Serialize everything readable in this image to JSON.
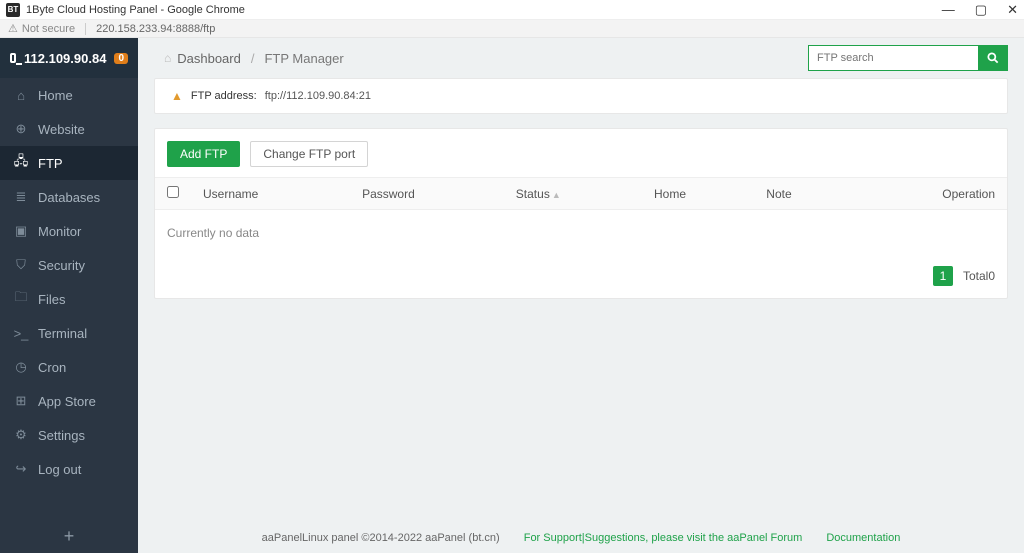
{
  "window": {
    "title": "1Byte Cloud Hosting Panel - Google Chrome",
    "favicon_text": "BT"
  },
  "address_bar": {
    "not_secure": "Not secure",
    "url": "220.158.233.94:8888/ftp"
  },
  "sidebar": {
    "host": "112.109.90.84",
    "badge": "0",
    "items": [
      {
        "label": "Home",
        "icon": "⌂"
      },
      {
        "label": "Website",
        "icon": "⊕"
      },
      {
        "label": "FTP",
        "icon": "🖧",
        "active": true
      },
      {
        "label": "Databases",
        "icon": "≣"
      },
      {
        "label": "Monitor",
        "icon": "▣"
      },
      {
        "label": "Security",
        "icon": "⛉"
      },
      {
        "label": "Files",
        "icon": "🗀"
      },
      {
        "label": "Terminal",
        "icon": ">_"
      },
      {
        "label": "Cron",
        "icon": "◷"
      },
      {
        "label": "App Store",
        "icon": "⊞"
      },
      {
        "label": "Settings",
        "icon": "⚙"
      },
      {
        "label": "Log out",
        "icon": "↪"
      }
    ]
  },
  "breadcrumb": {
    "root": "Dashboard",
    "current": "FTP Manager"
  },
  "search": {
    "placeholder": "FTP search"
  },
  "alert": {
    "label": "FTP address:",
    "value": "ftp://112.109.90.84:21"
  },
  "buttons": {
    "add": "Add FTP",
    "change_port": "Change FTP port"
  },
  "table": {
    "headers": {
      "username": "Username",
      "password": "Password",
      "status": "Status",
      "home": "Home",
      "note": "Note",
      "operation": "Operation"
    },
    "empty": "Currently no data"
  },
  "pager": {
    "page": "1",
    "total_label": "Total0"
  },
  "footer": {
    "copyright": "aaPanelLinux panel ©2014-2022 aaPanel (bt.cn)",
    "support": "For Support|Suggestions, please visit the aaPanel Forum",
    "docs": "Documentation"
  }
}
